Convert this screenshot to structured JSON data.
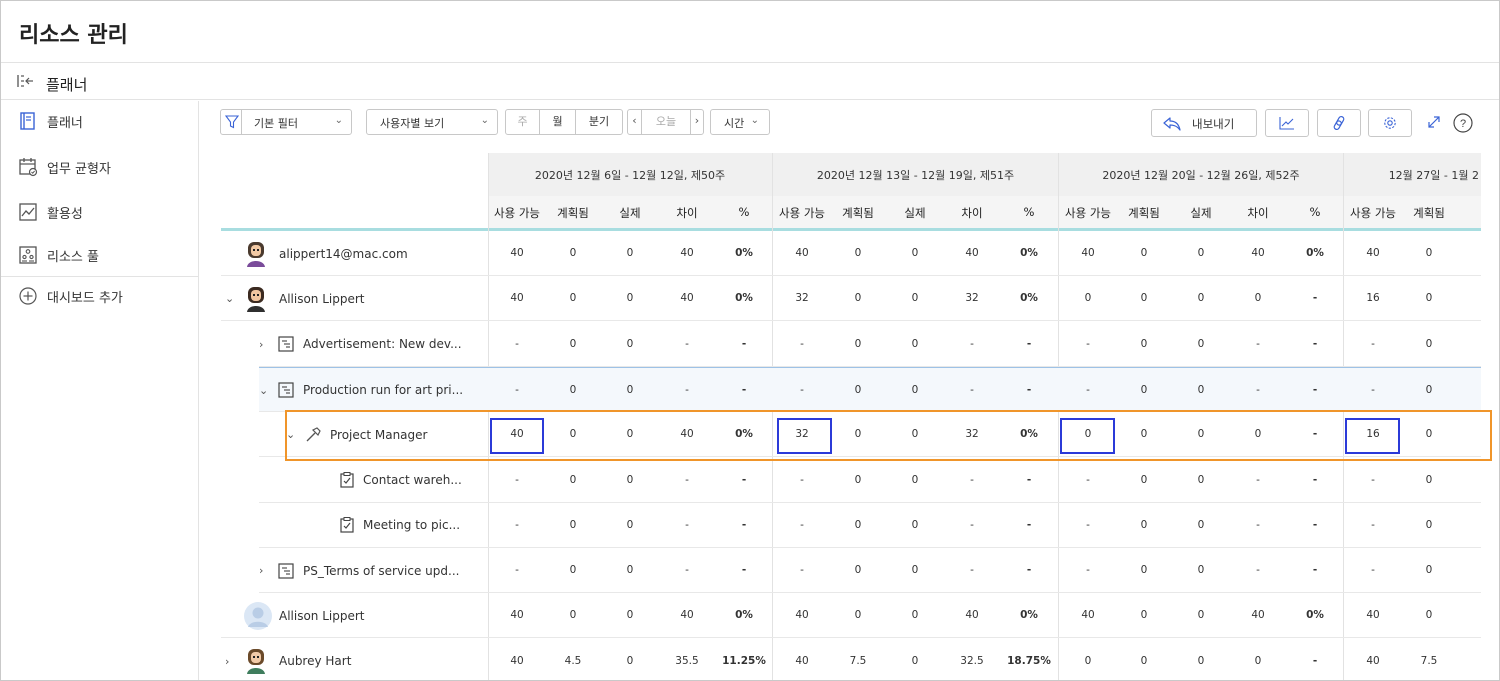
{
  "header": {
    "title": "리소스 관리"
  },
  "subheader": {
    "title": "플래너"
  },
  "sidebar": {
    "items": [
      {
        "label": "플래너",
        "icon": "planner-icon"
      },
      {
        "label": "업무 균형자",
        "icon": "calendar-check-icon"
      },
      {
        "label": "활용성",
        "icon": "chart-line-icon"
      },
      {
        "label": "리소스 풀",
        "icon": "people-icon"
      },
      {
        "label": "대시보드 추가",
        "icon": "plus-circle-icon"
      }
    ]
  },
  "toolbar": {
    "filter_label": "기본 필터",
    "view_label": "사용자별 보기",
    "week_label": "주",
    "month_label": "월",
    "quarter_label": "분기",
    "today_label": "오늘",
    "time_label": "시간",
    "export_label": "내보내기"
  },
  "weeks": [
    "2020년 12월 6일 - 12월 12일, 제50주",
    "2020년 12월 13일 - 12월 19일, 제51주",
    "2020년 12월 20일 - 12월 26일, 제52주",
    "12월 27일 - 1월 2"
  ],
  "columns": [
    "사용 가능",
    "계획됨",
    "실제",
    "차이",
    "%"
  ],
  "rows": [
    {
      "name": "alippert14@mac.com",
      "type": "user",
      "avatar": "female-purple",
      "cells": [
        "40",
        "0",
        "0",
        "40",
        "0%",
        "40",
        "0",
        "0",
        "40",
        "0%",
        "40",
        "0",
        "0",
        "40",
        "0%",
        "40",
        "0"
      ]
    },
    {
      "name": "Allison Lippert",
      "type": "user-expanded",
      "avatar": "female-dark",
      "cells": [
        "40",
        "0",
        "0",
        "40",
        "0%",
        "32",
        "0",
        "0",
        "32",
        "0%",
        "0",
        "0",
        "0",
        "0",
        "-",
        "16",
        "0"
      ]
    },
    {
      "name": "Advertisement: New dev...",
      "type": "project",
      "cells": [
        "-",
        "0",
        "0",
        "-",
        "-",
        "-",
        "0",
        "0",
        "-",
        "-",
        "-",
        "0",
        "0",
        "-",
        "-",
        "-",
        "0"
      ]
    },
    {
      "name": "Production run for art pri...",
      "type": "project-expanded",
      "cells": [
        "-",
        "0",
        "0",
        "-",
        "-",
        "-",
        "0",
        "0",
        "-",
        "-",
        "-",
        "0",
        "0",
        "-",
        "-",
        "-",
        "0"
      ]
    },
    {
      "name": "Project Manager",
      "type": "role",
      "cells": [
        "40",
        "0",
        "0",
        "40",
        "0%",
        "32",
        "0",
        "0",
        "32",
        "0%",
        "0",
        "0",
        "0",
        "0",
        "-",
        "16",
        "0"
      ]
    },
    {
      "name": "Contact wareh...",
      "type": "task",
      "cells": [
        "-",
        "0",
        "0",
        "-",
        "-",
        "-",
        "0",
        "0",
        "-",
        "-",
        "-",
        "0",
        "0",
        "-",
        "-",
        "-",
        "0"
      ]
    },
    {
      "name": "Meeting to pic...",
      "type": "task",
      "cells": [
        "-",
        "0",
        "0",
        "-",
        "-",
        "-",
        "0",
        "0",
        "-",
        "-",
        "-",
        "0",
        "0",
        "-",
        "-",
        "-",
        "0"
      ]
    },
    {
      "name": "PS_Terms of service upd...",
      "type": "project",
      "cells": [
        "-",
        "0",
        "0",
        "-",
        "-",
        "-",
        "0",
        "0",
        "-",
        "-",
        "-",
        "0",
        "0",
        "-",
        "-",
        "-",
        "0"
      ]
    },
    {
      "name": "Allison Lippert",
      "type": "user",
      "avatar": "placeholder",
      "cells": [
        "40",
        "0",
        "0",
        "40",
        "0%",
        "40",
        "0",
        "0",
        "40",
        "0%",
        "40",
        "0",
        "0",
        "40",
        "0%",
        "40",
        "0"
      ]
    },
    {
      "name": "Aubrey Hart",
      "type": "user-collapsed",
      "avatar": "female-brown",
      "cells": [
        "40",
        "4.5",
        "0",
        "35.5",
        "11.25%",
        "40",
        "7.5",
        "0",
        "32.5",
        "18.75%",
        "0",
        "0",
        "0",
        "0",
        "-",
        "40",
        "7.5"
      ]
    }
  ],
  "colors": {
    "selection": "#2b3ad8",
    "highlight_border": "#f0952a",
    "header_line": "#a8dde0"
  }
}
